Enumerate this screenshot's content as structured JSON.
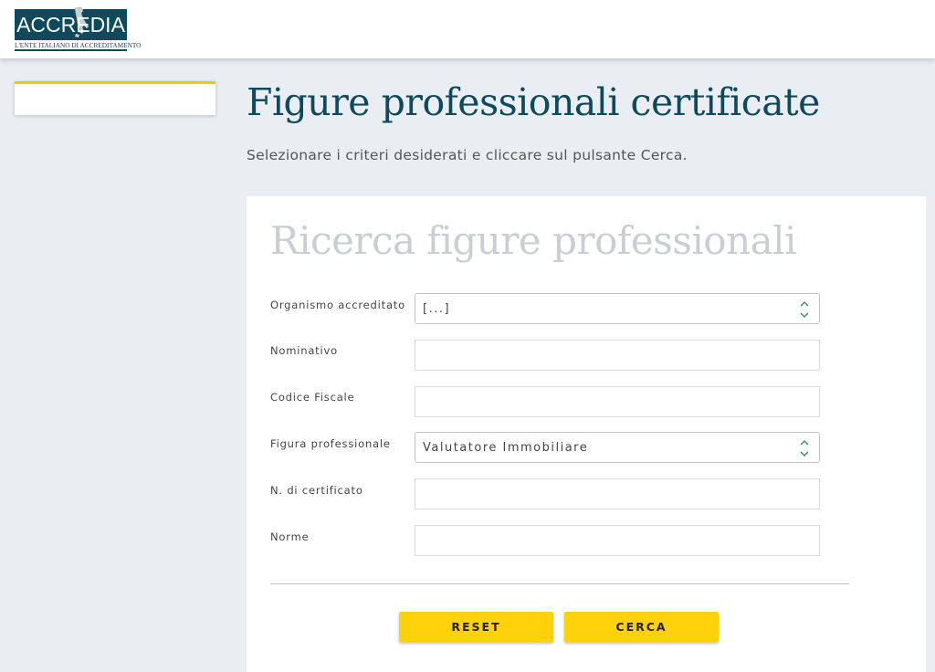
{
  "header": {
    "logo": {
      "wordmark": "ACCREDIA",
      "tagline": "L'ENTE ITALIANO DI ACCREDITAMENTO"
    }
  },
  "main": {
    "title": "Figure professionali certificate",
    "subtitle": "Selezionare i criteri desiderati e cliccare sul pulsante Cerca."
  },
  "form": {
    "title": "Ricerca figure professionali",
    "fields": {
      "organismo": {
        "label": "Organismo accreditato",
        "value": "[...]"
      },
      "nominativo": {
        "label": "Nominativo",
        "value": ""
      },
      "codice_fiscale": {
        "label": "Codice Fiscale",
        "value": ""
      },
      "figura": {
        "label": "Figura professionale",
        "value": "Valutatore Immobiliare"
      },
      "certificato": {
        "label": "N. di certificato",
        "value": ""
      },
      "norme": {
        "label": "Norme",
        "value": ""
      }
    },
    "buttons": {
      "reset": "RESET",
      "cerca": "CERCA"
    }
  },
  "colors": {
    "brand": "#0f4a5c",
    "accent": "#ffd108",
    "background": "#eaeef2"
  },
  "icons": {
    "select_arrows": "chevron-up-down-icon"
  }
}
